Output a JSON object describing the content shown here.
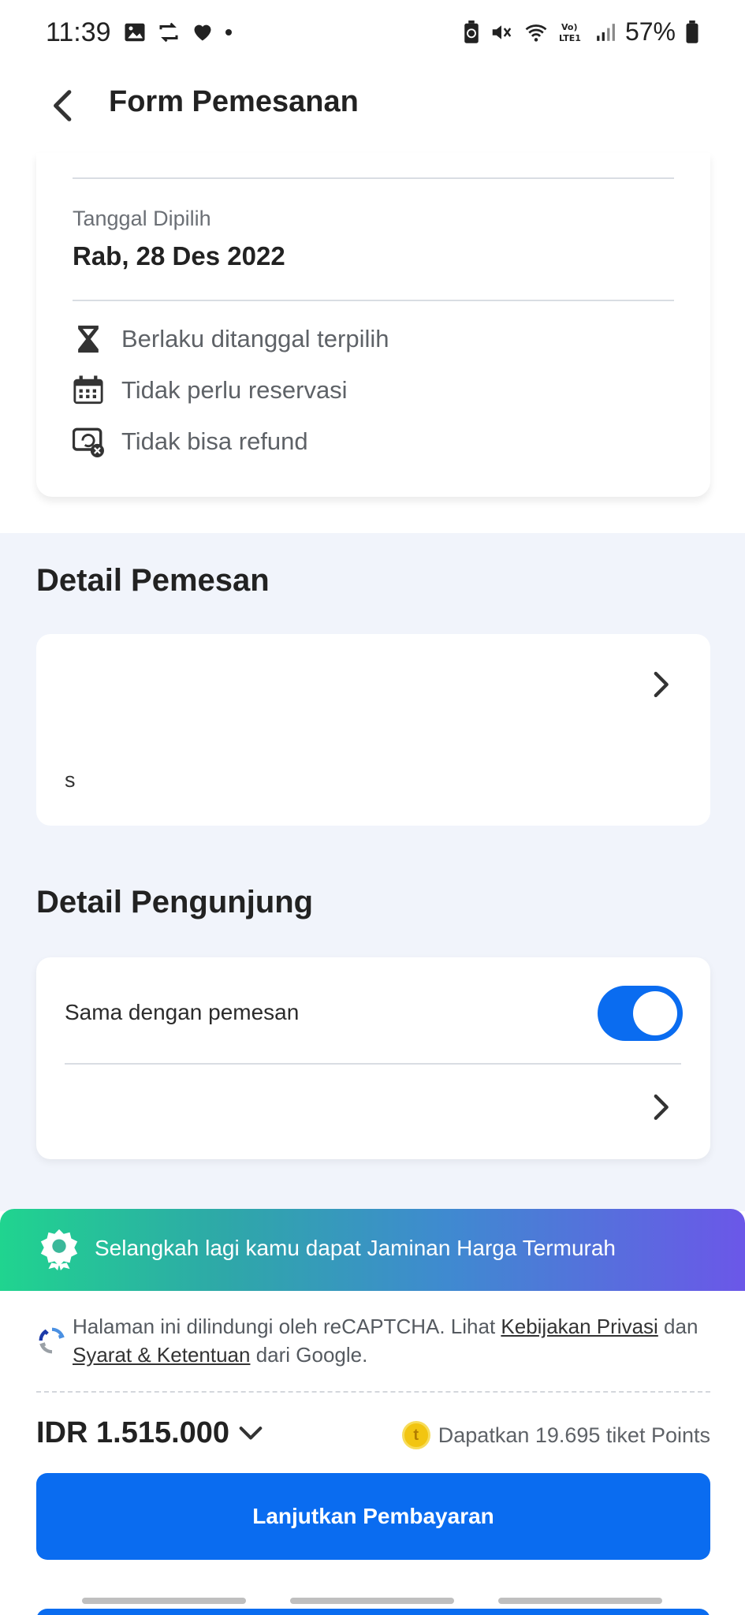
{
  "status_bar": {
    "time": "11:39",
    "battery": "57%"
  },
  "header": {
    "title": "Form Pemesanan"
  },
  "order_info": {
    "date_label": "Tanggal Dipilih",
    "date_value": "Rab, 28 Des 2022",
    "policies": [
      {
        "icon": "hourglass-icon",
        "text": "Berlaku ditanggal terpilih"
      },
      {
        "icon": "calendar-icon",
        "text": "Tidak perlu reservasi"
      },
      {
        "icon": "no-refund-icon",
        "text": "Tidak bisa refund"
      }
    ]
  },
  "booker": {
    "title": "Detail Pemesan",
    "card_text": "s"
  },
  "visitor": {
    "title": "Detail Pengunjung",
    "same_as_booker_label": "Sama dengan pemesan",
    "same_as_booker_on": true
  },
  "banner": {
    "text": "Selangkah lagi kamu dapat Jaminan Harga Termurah"
  },
  "captcha": {
    "text_prefix": "Halaman ini dilindungi oleh reCAPTCHA. Lihat ",
    "privacy_link": "Kebijakan Privasi",
    "text_mid": " dan ",
    "terms_link": "Syarat & Ketentuan",
    "text_suffix": " dari Google."
  },
  "summary": {
    "price": "IDR 1.515.000",
    "points_text": "Dapatkan 19.695 tiket Points",
    "coin_symbol": "t"
  },
  "cta": {
    "label": "Lanjutkan Pembayaran"
  },
  "colors": {
    "primary": "#0a6cf0",
    "background_grey": "#f1f4fb"
  }
}
